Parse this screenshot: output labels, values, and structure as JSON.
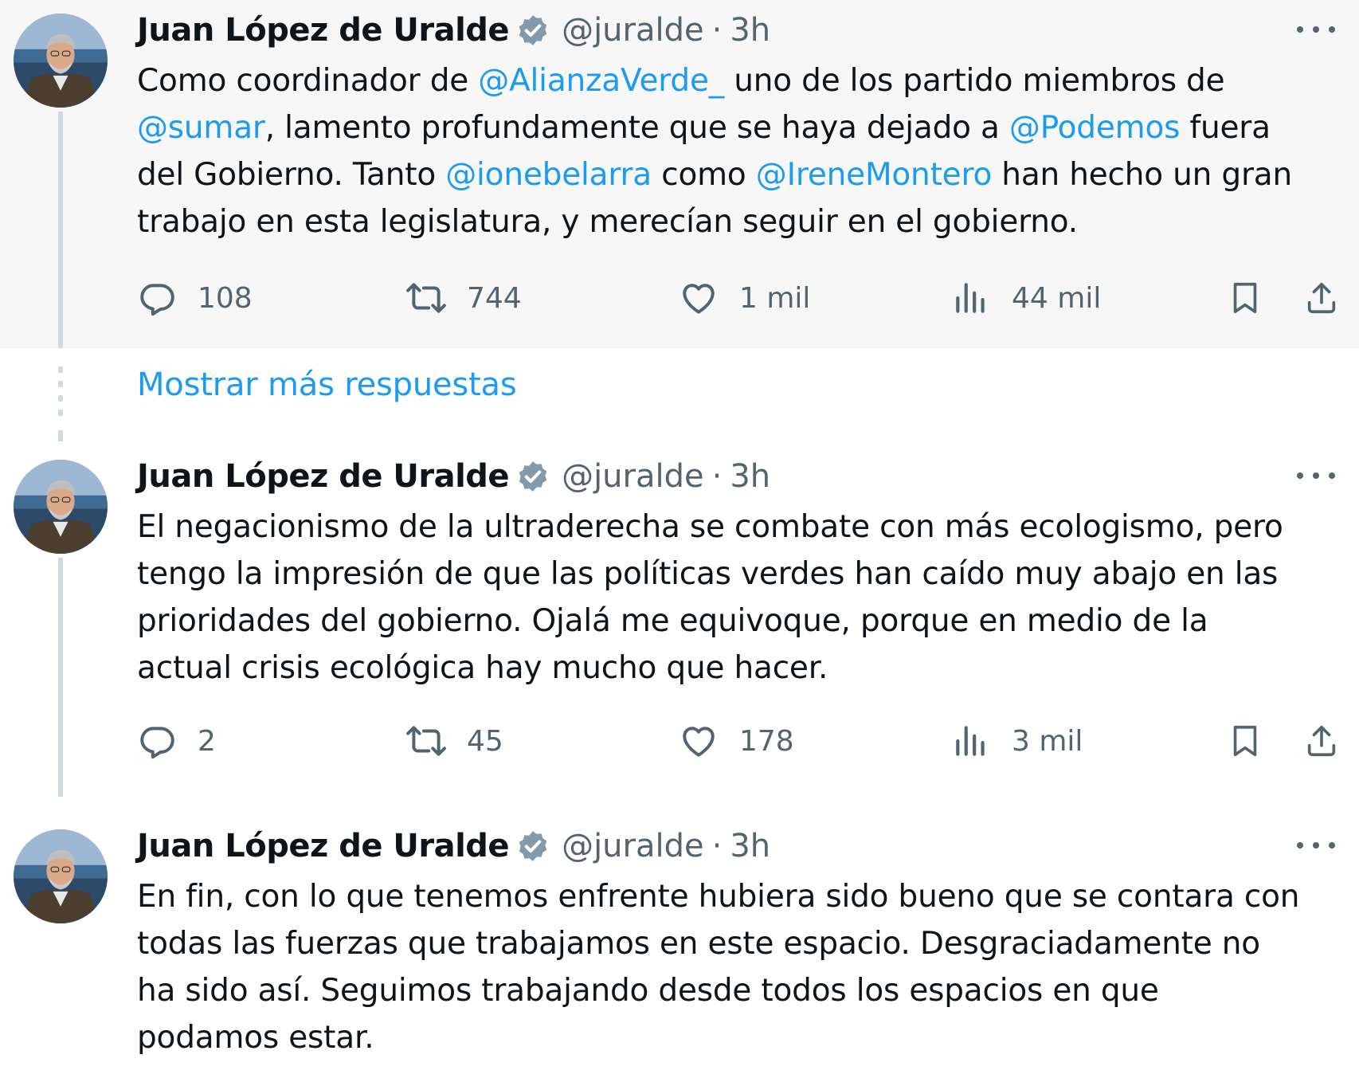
{
  "colors": {
    "link": "#1d9bf0",
    "text": "#0f1419",
    "muted": "#536471",
    "verified": "#829aab",
    "thread_line": "#cfd9de"
  },
  "show_more_replies": "Mostrar más respuestas",
  "tweets": [
    {
      "author": {
        "name": "Juan López de Uralde",
        "handle": "@juralde",
        "separator": "·",
        "time": "3h",
        "verified": true,
        "verified_icon": "verified-badge-icon"
      },
      "lines": [
        [
          {
            "t": "Como coordinador de "
          },
          {
            "t": "@AlianzaVerde_",
            "mention": true
          },
          {
            "t": " uno de los  partido miembros de"
          }
        ],
        [
          {
            "t": "@sumar",
            "mention": true
          },
          {
            "t": ", lamento profundamente que se haya dejado a "
          },
          {
            "t": "@Podemos",
            "mention": true
          },
          {
            "t": " fuera"
          }
        ],
        [
          {
            "t": "del Gobierno. Tanto "
          },
          {
            "t": "@ionebelarra",
            "mention": true
          },
          {
            "t": " como "
          },
          {
            "t": "@IreneMontero",
            "mention": true
          },
          {
            "t": " han hecho un gran"
          }
        ],
        [
          {
            "t": "trabajo en esta legislatura, y merecían seguir en el gobierno."
          }
        ]
      ],
      "stats": {
        "replies": "108",
        "retweets": "744",
        "likes": "1 mil",
        "views": "44 mil"
      }
    },
    {
      "author": {
        "name": "Juan López de Uralde",
        "handle": "@juralde",
        "separator": "·",
        "time": "3h",
        "verified": true,
        "verified_icon": "verified-badge-icon"
      },
      "lines": [
        [
          {
            "t": "El negacionismo de la ultraderecha se combate con más ecologismo, pero"
          }
        ],
        [
          {
            "t": "tengo la impresión de que las políticas verdes han caído muy abajo en las"
          }
        ],
        [
          {
            "t": "prioridades del gobierno. Ojalá me equivoque, porque en medio de la"
          }
        ],
        [
          {
            "t": "actual crisis ecológica hay mucho que hacer."
          }
        ]
      ],
      "stats": {
        "replies": "2",
        "retweets": "45",
        "likes": "178",
        "views": "3 mil"
      }
    },
    {
      "author": {
        "name": "Juan López de Uralde",
        "handle": "@juralde",
        "separator": "·",
        "time": "3h",
        "verified": true,
        "verified_icon": "verified-badge-icon"
      },
      "lines": [
        [
          {
            "t": "En fin, con lo que tenemos enfrente hubiera sido bueno que se contara con"
          }
        ],
        [
          {
            "t": "todas las fuerzas que trabajamos en este espacio. Desgraciadamente no"
          }
        ],
        [
          {
            "t": "ha sido así. Seguimos trabajando desde todos los espacios en que"
          }
        ],
        [
          {
            "t": "podamos estar."
          }
        ]
      ]
    }
  ],
  "icons": {
    "reply": "reply-icon",
    "retweet": "retweet-icon",
    "like": "heart-icon",
    "views": "views-chart-icon",
    "bookmark": "bookmark-icon",
    "share": "share-icon",
    "more": "more-options-icon"
  }
}
